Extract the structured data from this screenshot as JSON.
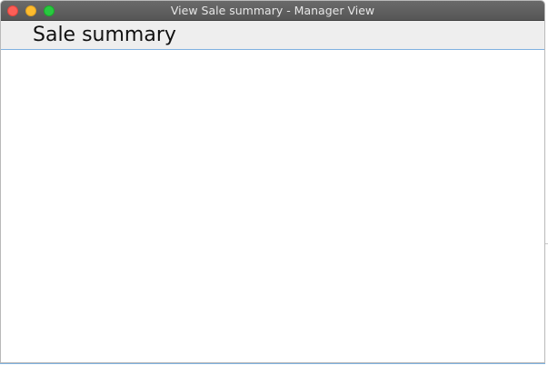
{
  "window": {
    "title": "View Sale summary - Manager View",
    "controls": {
      "close": "close-icon",
      "minimize": "minimize-icon",
      "zoom": "zoom-icon"
    }
  },
  "header": {
    "title": "Sale summary"
  },
  "colors": {
    "titlebar": "#5e5e5e",
    "header_bg": "#eeeeee",
    "accent_border": "#7fb1e0",
    "close": "#fc5f57",
    "minimize": "#fdbc2e",
    "zoom": "#28c940"
  }
}
